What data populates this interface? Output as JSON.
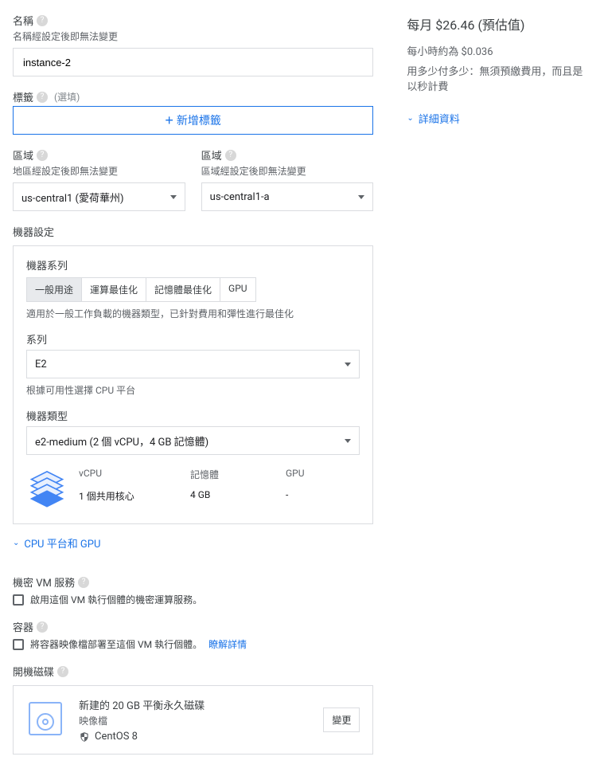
{
  "name": {
    "label": "名稱",
    "helper": "名稱經設定後即無法變更",
    "value": "instance-2"
  },
  "labels": {
    "label": "標籤",
    "optional": "(選填)",
    "add_btn": "新增標籤"
  },
  "region": {
    "label": "區域",
    "helper": "地區經設定後即無法變更",
    "value": "us-central1 (愛荷華州)"
  },
  "zone": {
    "label": "區域",
    "helper": "區域經設定後即無法變更",
    "value": "us-central1-a"
  },
  "machine_config": {
    "label": "機器設定",
    "family_label": "機器系列",
    "tabs": [
      "一般用途",
      "運算最佳化",
      "記憶體最佳化",
      "GPU"
    ],
    "tab_desc": "適用於一般工作負載的機器類型，已針對費用和彈性進行最佳化",
    "series_label": "系列",
    "series_value": "E2",
    "series_helper": "根據可用性選擇 CPU 平台",
    "type_label": "機器類型",
    "type_value": "e2-medium (2 個 vCPU，4 GB 記憶體)",
    "spec": {
      "vcpu_hdr": "vCPU",
      "mem_hdr": "記憶體",
      "gpu_hdr": "GPU",
      "vcpu_val": "1 個共用核心",
      "mem_val": "4 GB",
      "gpu_val": "-"
    }
  },
  "cpu_gpu_expand": "CPU 平台和 GPU",
  "confidential_vm": {
    "label": "機密 VM 服務",
    "checkbox": "啟用這個 VM 執行個體的機密運算服務。"
  },
  "container": {
    "label": "容器",
    "checkbox": "將容器映像檔部署至這個 VM 執行個體。",
    "learn_more": "瞭解詳情"
  },
  "boot_disk": {
    "label": "開機磁碟",
    "title": "新建的 20 GB 平衡永久磁碟",
    "image_label": "映像檔",
    "os": "CentOS 8",
    "change_btn": "變更"
  },
  "pricing": {
    "monthly": "每月 $26.46 (預估值)",
    "hourly": "每小時約為 $0.036",
    "payg": "用多少付多少：無須預繳費用，而且是以秒計費",
    "details": "詳細資料"
  }
}
